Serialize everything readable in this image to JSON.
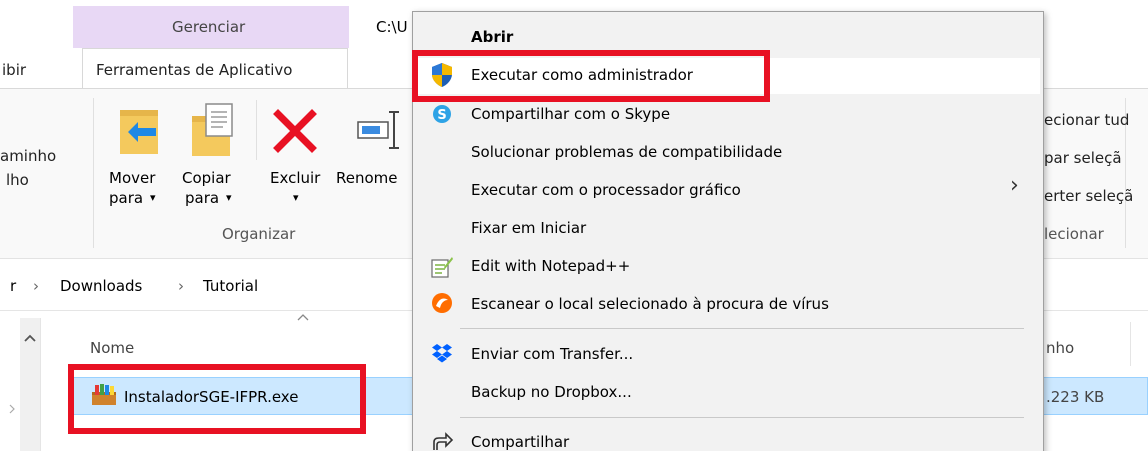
{
  "ribbon": {
    "tab_manage": "Gerenciar",
    "tab_view_partial": "ibir",
    "tab_app_tools": "Ferramentas de Aplicativo",
    "path_partial": "C:\\U",
    "left_partial_1": "aminho",
    "left_partial_2": "lho",
    "move_line1": "Mover",
    "move_line2": "para",
    "copy_line1": "Copiar",
    "copy_line2": "para",
    "delete_label": "Excluir",
    "rename_partial": "Renome",
    "group_organize": "Organizar",
    "select_all_partial": "ecionar tud",
    "select_none_partial": "par seleçã",
    "invert_partial": "erter seleçã",
    "group_select_partial": "lecionar",
    "dropdown_glyph": "▾"
  },
  "address": {
    "root_glyph": "r",
    "sep_glyph": "›",
    "crumbs": [
      "Downloads",
      "Tutorial"
    ]
  },
  "list": {
    "col_name": "Nome",
    "col_size_partial": "nho",
    "sort_glyph": "^",
    "file_name": "InstaladorSGE-IFPR.exe",
    "file_size_partial": ".223 KB"
  },
  "menu": {
    "items": [
      {
        "label": "Abrir"
      },
      {
        "label": "Executar como administrador"
      },
      {
        "label": "Compartilhar com o Skype"
      },
      {
        "label": "Solucionar problemas de compatibilidade"
      },
      {
        "label": "Executar com o processador gráfico"
      },
      {
        "label": "Fixar em Iniciar"
      },
      {
        "label": "Edit with Notepad++"
      },
      {
        "label": "Escanear o local selecionado à procura de vírus"
      },
      {
        "label": "Enviar com Transfer..."
      },
      {
        "label": "Backup no Dropbox..."
      },
      {
        "label": "Compartilhar"
      }
    ],
    "submenu_arrow": "›"
  },
  "colors": {
    "highlight_red": "#e81123",
    "manage_tab": "#e8d8f5",
    "selection": "#cce8ff"
  }
}
